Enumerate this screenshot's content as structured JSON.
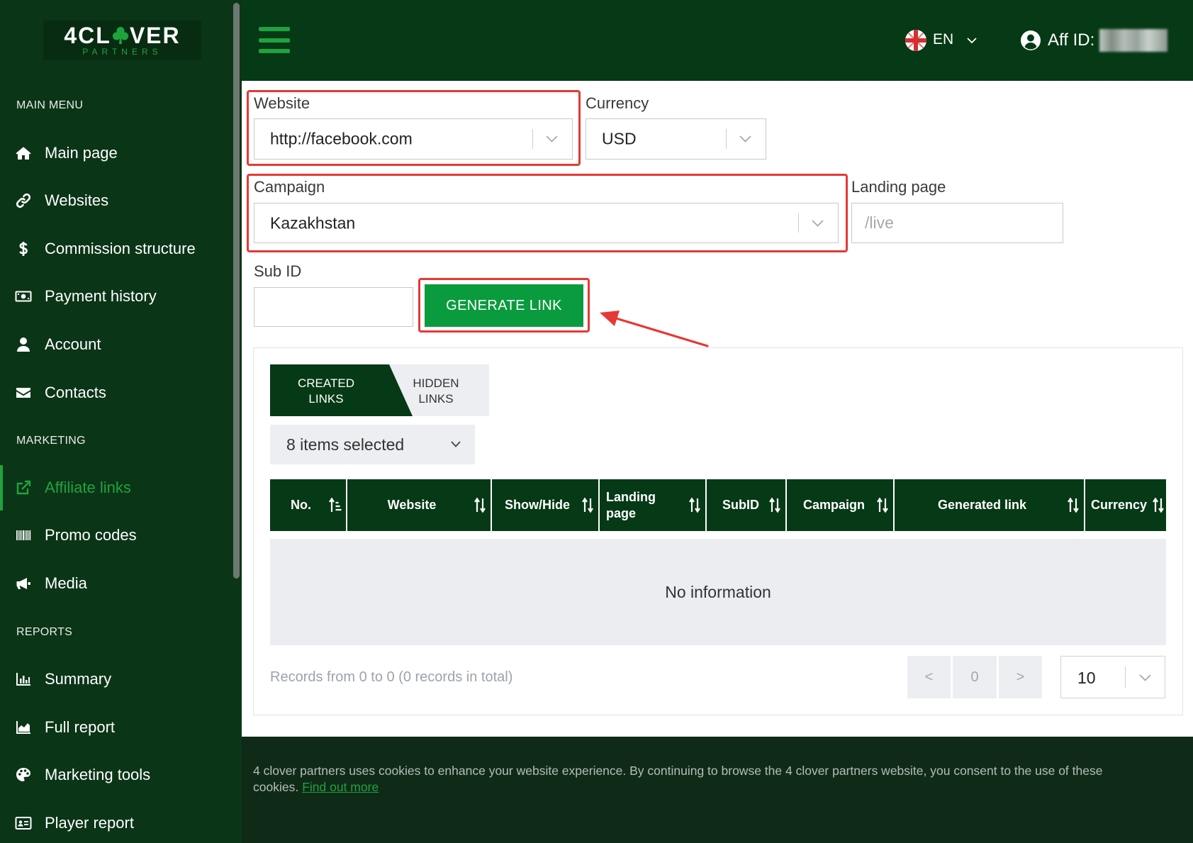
{
  "brand": {
    "logo_prefix": "4CL",
    "logo_suffix": "VER",
    "logo_sub": "PARTNERS",
    "logo_icon": "clover-icon"
  },
  "sidebar": {
    "sections": [
      {
        "title": "MAIN MENU",
        "items": [
          {
            "label": "Main page",
            "icon": "home-icon"
          },
          {
            "label": "Websites",
            "icon": "link-icon"
          },
          {
            "label": "Commission structure",
            "icon": "dollar-icon"
          },
          {
            "label": "Payment history",
            "icon": "money-bill-icon"
          },
          {
            "label": "Account",
            "icon": "user-icon"
          },
          {
            "label": "Contacts",
            "icon": "envelope-icon"
          }
        ]
      },
      {
        "title": "MARKETING",
        "items": [
          {
            "label": "Affiliate links",
            "icon": "external-link-icon",
            "active": true
          },
          {
            "label": "Promo codes",
            "icon": "barcode-icon"
          },
          {
            "label": "Media",
            "icon": "megaphone-icon"
          }
        ]
      },
      {
        "title": "REPORTS",
        "items": [
          {
            "label": "Summary",
            "icon": "bar-chart-icon"
          },
          {
            "label": "Full report",
            "icon": "area-chart-icon"
          },
          {
            "label": "Marketing tools",
            "icon": "palette-icon"
          },
          {
            "label": "Player report",
            "icon": "id-card-icon"
          }
        ]
      }
    ]
  },
  "header": {
    "menu_icon": "hamburger-icon",
    "language": "EN",
    "language_icon": "flag-icon",
    "aff_id_label": "Aff ID:",
    "user_icon": "user-circle-icon"
  },
  "form": {
    "website": {
      "label": "Website",
      "value": "http://facebook.com"
    },
    "currency": {
      "label": "Currency",
      "value": "USD"
    },
    "campaign": {
      "label": "Campaign",
      "value": "Kazakhstan"
    },
    "landing_page": {
      "label": "Landing page",
      "placeholder": "/live"
    },
    "sub_id": {
      "label": "Sub ID"
    },
    "generate_button": "GENERATE LINK"
  },
  "tabs": [
    {
      "label": "CREATED LINKS",
      "active": true
    },
    {
      "label": "HIDDEN LINKS",
      "active": false
    }
  ],
  "column_filter": {
    "value": "8 items selected"
  },
  "table": {
    "columns": [
      {
        "label": "No.",
        "sort_icon": "sort-asc-icon"
      },
      {
        "label": "Website",
        "sort_icon": "sort-icon"
      },
      {
        "label": "Show/Hide",
        "sort_icon": "sort-icon"
      },
      {
        "label": "Landing page",
        "sort_icon": "sort-icon"
      },
      {
        "label": "SubID",
        "sort_icon": "sort-icon"
      },
      {
        "label": "Campaign",
        "sort_icon": "sort-icon"
      },
      {
        "label": "Generated link",
        "sort_icon": "sort-icon"
      },
      {
        "label": "Currency",
        "sort_icon": "sort-icon"
      }
    ],
    "rows": [],
    "empty_text": "No information"
  },
  "pagination": {
    "summary": "Records from 0 to 0 (0 records in total)",
    "prev": "<",
    "current": "0",
    "next": ">",
    "page_size": "10"
  },
  "cookie": {
    "text": "4 clover partners uses cookies to enhance your website experience. By continuing to browse the 4 clover partners website, you consent to the use of these cookies.",
    "link": "Find out more"
  },
  "colors": {
    "sidebar_bg": "#0b3517",
    "header_bg": "#063916",
    "accent_green": "#1fa33f",
    "button_green": "#0a9b3e",
    "annotation_red": "#e53935",
    "cookie_bg": "#102a18"
  }
}
